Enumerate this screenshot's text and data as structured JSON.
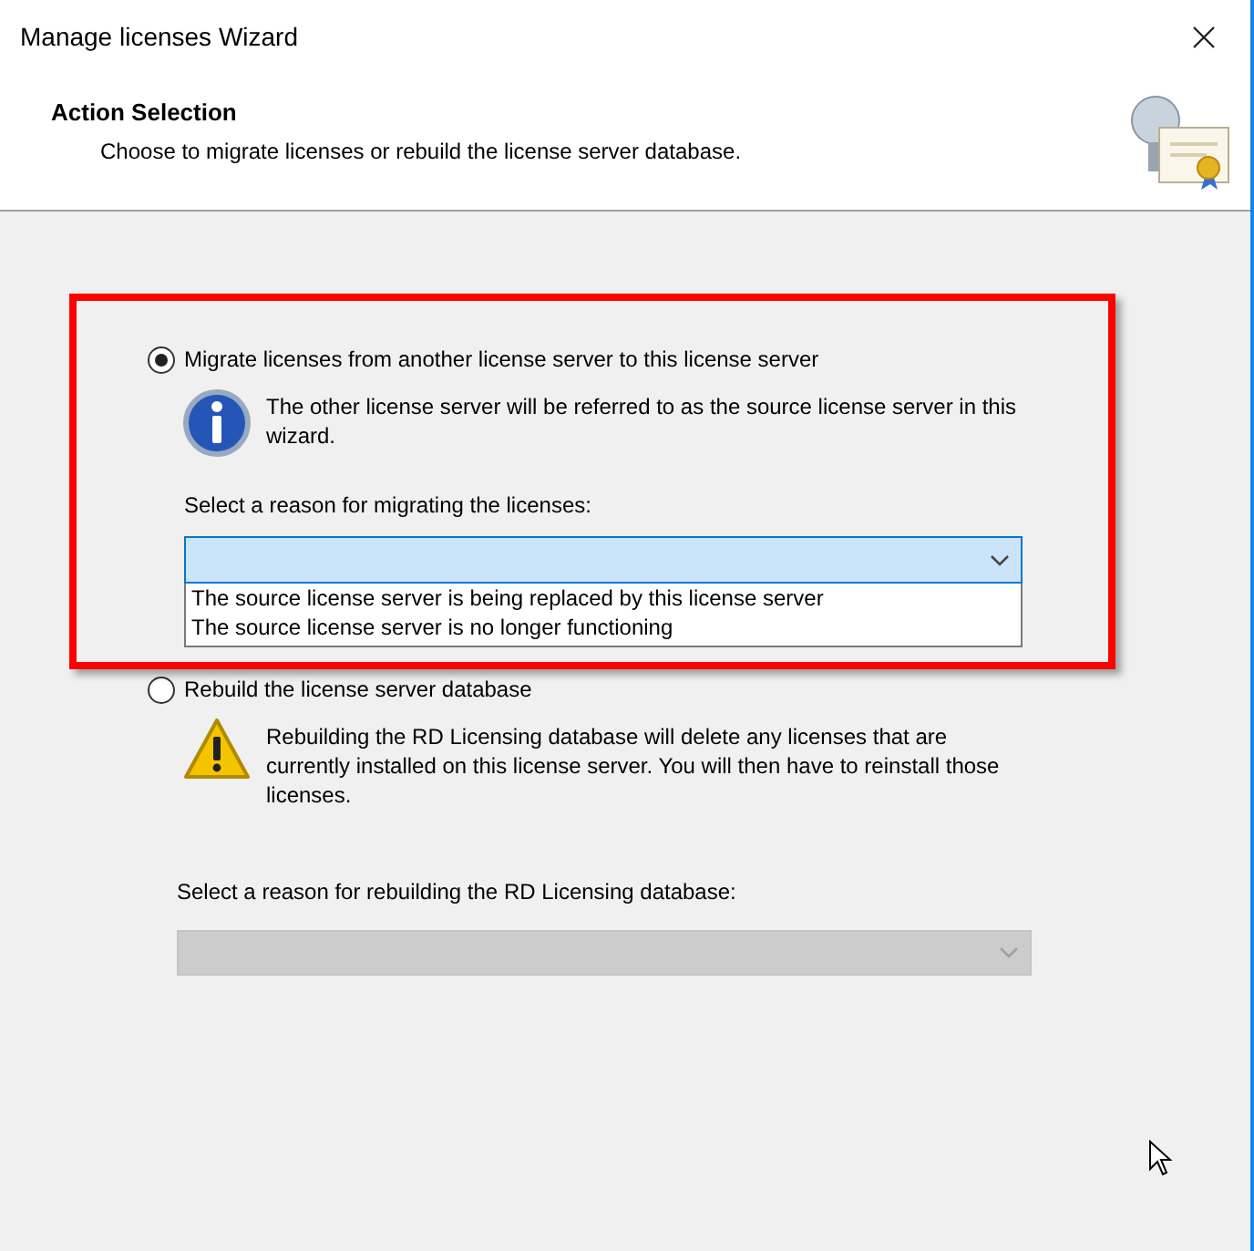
{
  "window": {
    "title": "Manage licenses Wizard"
  },
  "header": {
    "title": "Action Selection",
    "subtitle": "Choose to migrate licenses or rebuild the license server database."
  },
  "options": [
    {
      "label": "Migrate licenses from another license server to this license server",
      "selected": true,
      "note": {
        "kind": "info",
        "text": "The other license server will be referred to as the source license server in this wizard."
      },
      "reason_label": "Select a reason for migrating the licenses:",
      "dropdown": {
        "disabled": false,
        "expanded": true,
        "items": [
          "The source license server is being replaced by this license server",
          "The source license server is no longer functioning"
        ]
      }
    },
    {
      "label": "Rebuild the license server database",
      "selected": false,
      "note": {
        "kind": "warning",
        "text": "Rebuilding the RD Licensing database will delete any licenses that are currently installed on this license server. You will then have to reinstall those licenses."
      },
      "reason_label": "Select a reason for rebuilding the RD Licensing database:",
      "dropdown": {
        "disabled": true,
        "expanded": false
      }
    }
  ]
}
